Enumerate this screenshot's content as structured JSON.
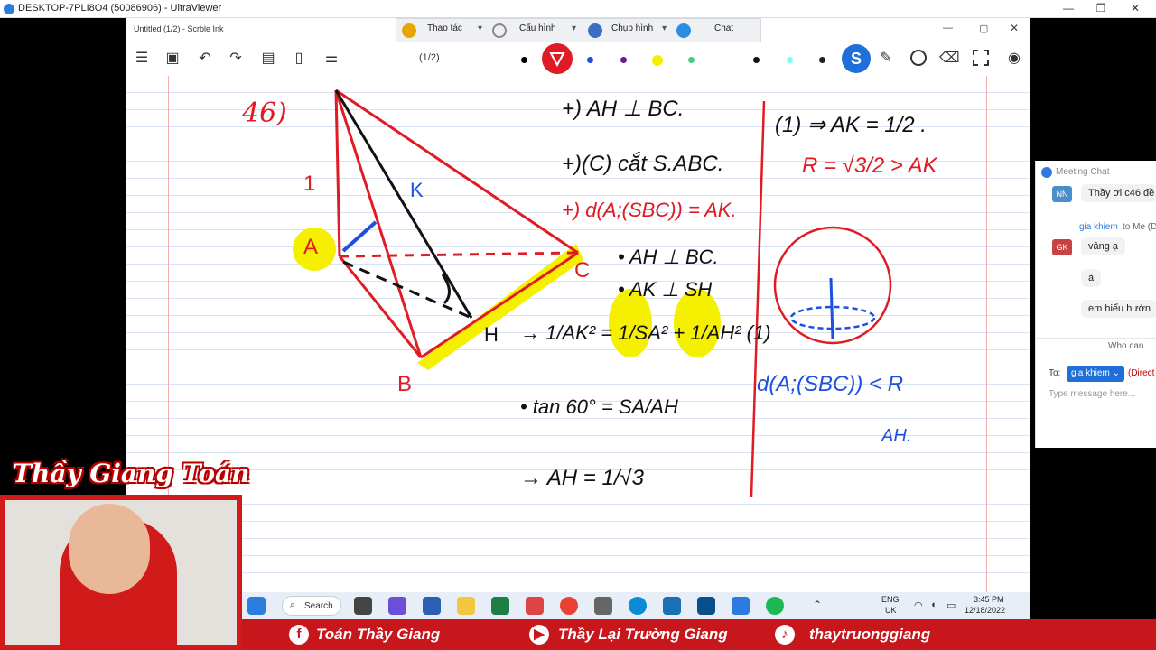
{
  "ultraviewer": {
    "title": "DESKTOP-7PLI8O4 (50086906) - UltraViewer",
    "minimize": "—",
    "maximize": "❐",
    "close": "✕"
  },
  "app": {
    "title": "Untitled (1/2) - Scrble Ink",
    "page_indicator": "(1/2)"
  },
  "uv_menu": {
    "actions": "Thao tác",
    "config": "Cấu hình",
    "capture": "Chụp hình",
    "chat": "Chat"
  },
  "colors": {
    "pen_red": "#e01b24",
    "pen_blue": "#1d4fe0",
    "highlight": "#f5f000",
    "accent": "#1e6fd9",
    "banner": "#c8161d"
  },
  "toolbar_icons": [
    "menu-icon",
    "save-icon",
    "undo-icon",
    "redo-icon",
    "clipboard-icon",
    "page-icon",
    "settings-icon"
  ],
  "handwriting": {
    "problem_no": "46)",
    "label_1": "1",
    "label_A": "A",
    "label_B": "B",
    "label_C": "C",
    "label_H": "H",
    "label_K": "K",
    "line1": "+) AH ⊥ BC.",
    "line2": "+)(C) cắt S.ABC.",
    "line3": "+) d(A;(SBC)) = AK.",
    "line4": "• AH ⊥ BC.",
    "line5": "• AK ⊥ SH",
    "line6": "→ 1/AK² = 1/SA² + 1/AH² (1)",
    "line7": "• tan 60° = SA/AH",
    "line8": "→ AH = 1/√3",
    "right1": "(1) ⇒ AK = 1/2 .",
    "right2": "R = √3/2 > AK",
    "right3": "d(A;(SBC)) < R",
    "right4": "AH."
  },
  "chat": {
    "header": "Meeting Chat",
    "messages": [
      {
        "initials": "NN",
        "text": "Thầy ơi c46 đề"
      },
      {
        "meta_name": "gia khiem",
        "meta_to": " to Me (D",
        "initials": "GK",
        "text": "vâng ạ"
      },
      {
        "text": "à"
      },
      {
        "text": "em hiểu hướn"
      }
    ],
    "who_can": "Who can",
    "to_label": "To:",
    "to_value": "gia khiem ⌄",
    "direct": "(Direct",
    "placeholder": "Type message here..."
  },
  "webcam": {
    "title": "Thầy Giang Toán"
  },
  "taskbar": {
    "search": "Search",
    "lang1": "ENG",
    "lang2": "UK",
    "time": "3:45 PM",
    "date": "12/18/2022"
  },
  "banner": {
    "facebook": "Toán Thầy Giang",
    "youtube": "Thầy Lại Trường Giang",
    "tiktok": "thaytruonggiang"
  }
}
